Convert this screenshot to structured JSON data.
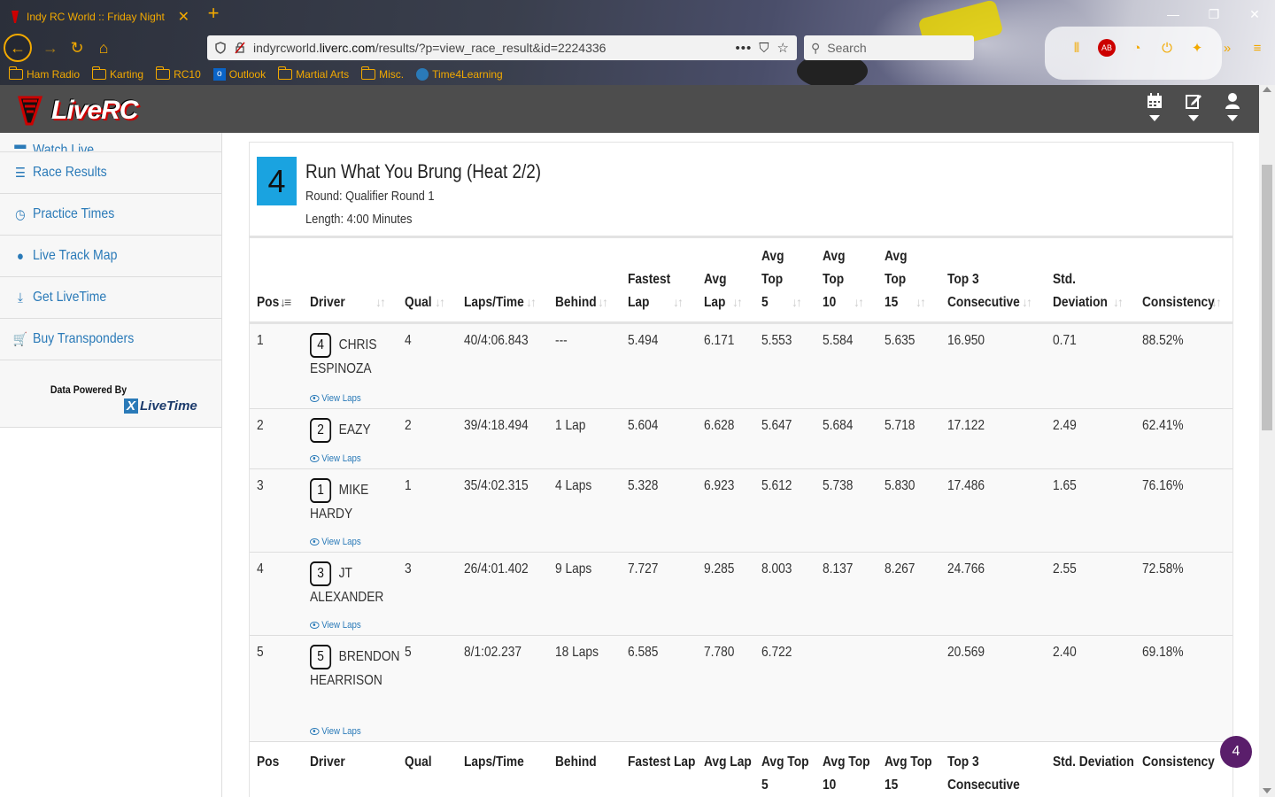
{
  "browser": {
    "tab_title": "Indy RC World :: Friday Night",
    "url_prefix": "indyrcworld.",
    "url_domain": "liverc.com",
    "url_path": "/results/?p=view_race_result&id=2224336",
    "search_placeholder": "Search",
    "page_actions": "•••",
    "bookmarks": [
      {
        "label": "Ham Radio",
        "icon": "folder-icon"
      },
      {
        "label": "Karting",
        "icon": "folder-icon"
      },
      {
        "label": "RC10",
        "icon": "folder-icon"
      },
      {
        "label": "Outlook",
        "icon": "outlook-icon"
      },
      {
        "label": "Martial Arts",
        "icon": "folder-icon"
      },
      {
        "label": "Misc.",
        "icon": "folder-icon"
      },
      {
        "label": "Time4Learning",
        "icon": "globe-icon"
      }
    ],
    "accent_color": "#f2a900"
  },
  "site": {
    "logo_text": "LiveRC",
    "header_icons": [
      "calendar-icon",
      "edit-icon",
      "user-icon"
    ]
  },
  "sidebar": {
    "partial_item": "Watch Live",
    "items": [
      {
        "label": "Race Results",
        "icon": "list-icon"
      },
      {
        "label": "Practice Times",
        "icon": "clock-icon"
      },
      {
        "label": "Live Track Map",
        "icon": "globe-icon"
      },
      {
        "label": "Get LiveTime",
        "icon": "download-icon"
      },
      {
        "label": "Buy Transponders",
        "icon": "cart-icon"
      }
    ],
    "powered_by": "Data Powered By",
    "powered_logo": "LiveTime"
  },
  "race": {
    "number": "4",
    "title": "Run What You Brung (Heat 2/2)",
    "round": "Round: Qualifier Round 1",
    "length": "Length: 4:00 Minutes"
  },
  "table": {
    "headers": {
      "pos": "Pos",
      "driver": "Driver",
      "qual": "Qual",
      "laps_time": "Laps/Time",
      "behind": "Behind",
      "fastest_1": "Fastest",
      "fastest_2": "Lap",
      "avg_1": "Avg",
      "avg_2": "Lap",
      "top5_1": "Avg",
      "top5_2": "Top",
      "top5_3": "5",
      "top10_1": "Avg",
      "top10_2": "Top",
      "top10_3": "10",
      "top15_1": "Avg",
      "top15_2": "Top",
      "top15_3": "15",
      "top3c_1": "Top 3",
      "top3c_2": "Consecutive",
      "std_1": "Std.",
      "std_2": "Deviation",
      "consistency": "Consistency"
    },
    "footer": {
      "pos": "Pos",
      "driver": "Driver",
      "qual": "Qual",
      "laps_time": "Laps/Time",
      "behind": "Behind",
      "fastest": "Fastest Lap",
      "avg": "Avg Lap",
      "top5_1": "Avg Top",
      "top5_2": "5",
      "top10_1": "Avg Top",
      "top10_2": "10",
      "top15_1": "Avg Top",
      "top15_2": "15",
      "top3c_1": "Top 3",
      "top3c_2": "Consecutive",
      "std": "Std. Deviation",
      "consistency": "Consistency"
    },
    "view_laps": "View Laps",
    "rows": [
      {
        "pos": "1",
        "car": "4",
        "driver": "CHRIS ESPINOZA",
        "qual": "4",
        "laps_time": "40/4:06.843",
        "behind": "---",
        "fastest": "5.494",
        "avg": "6.171",
        "top5": "5.553",
        "top10": "5.584",
        "top15": "5.635",
        "top3c": "16.950",
        "std": "0.71",
        "consistency": "88.52%"
      },
      {
        "pos": "2",
        "car": "2",
        "driver": "EAZY",
        "qual": "2",
        "laps_time": "39/4:18.494",
        "behind": "1 Lap",
        "fastest": "5.604",
        "avg": "6.628",
        "top5": "5.647",
        "top10": "5.684",
        "top15": "5.718",
        "top3c": "17.122",
        "std": "2.49",
        "consistency": "62.41%"
      },
      {
        "pos": "3",
        "car": "1",
        "driver": "MIKE HARDY",
        "qual": "1",
        "laps_time": "35/4:02.315",
        "behind": "4 Laps",
        "fastest": "5.328",
        "avg": "6.923",
        "top5": "5.612",
        "top10": "5.738",
        "top15": "5.830",
        "top3c": "17.486",
        "std": "1.65",
        "consistency": "76.16%"
      },
      {
        "pos": "4",
        "car": "3",
        "driver": "JT ALEXANDER",
        "qual": "3",
        "laps_time": "26/4:01.402",
        "behind": "9 Laps",
        "fastest": "7.727",
        "avg": "9.285",
        "top5": "8.003",
        "top10": "8.137",
        "top15": "8.267",
        "top3c": "24.766",
        "std": "2.55",
        "consistency": "72.58%"
      },
      {
        "pos": "5",
        "car": "5",
        "driver": "BRENDON HEARRISON",
        "qual": "5",
        "laps_time": "8/1:02.237",
        "behind": "18 Laps",
        "fastest": "6.585",
        "avg": "7.780",
        "top5": "6.722",
        "top10": "",
        "top15": "",
        "top3c": "20.569",
        "std": "2.40",
        "consistency": "69.18%"
      }
    ]
  },
  "notification_badge": "4"
}
